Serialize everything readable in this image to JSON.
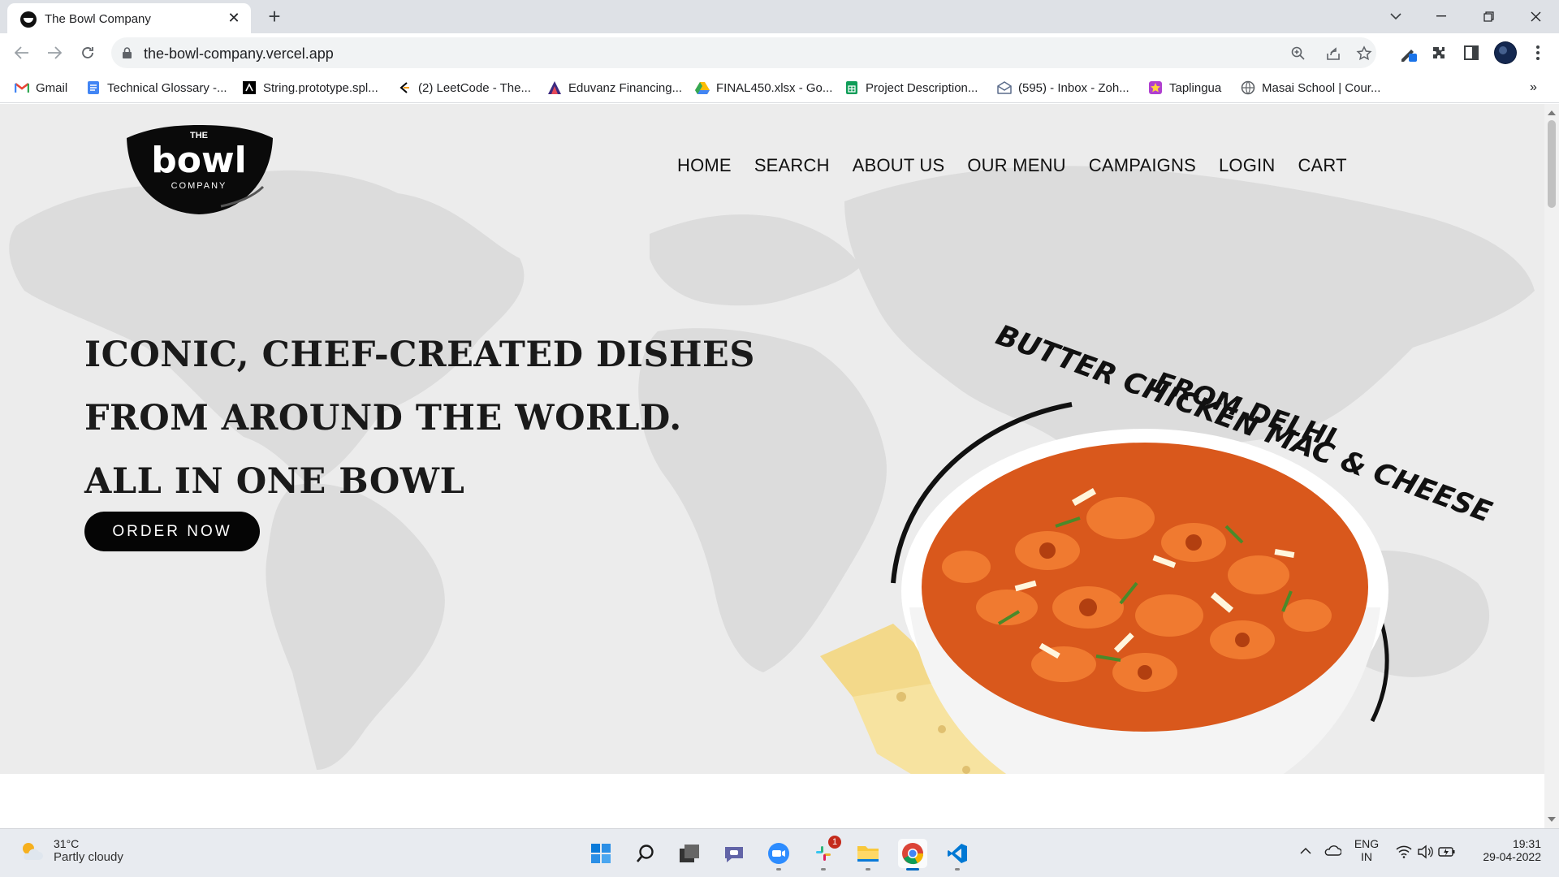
{
  "browser": {
    "tab": {
      "title": "The Bowl Company"
    },
    "url": "the-bowl-company.vercel.app",
    "bookmarks": [
      {
        "label": "Gmail",
        "icon": "gmail-icon"
      },
      {
        "label": "Technical Glossary -...",
        "icon": "docs-icon"
      },
      {
        "label": "String.prototype.spl...",
        "icon": "mdn-icon"
      },
      {
        "label": "(2) LeetCode - The...",
        "icon": "leetcode-icon"
      },
      {
        "label": "Eduvanz Financing...",
        "icon": "eduvanz-icon"
      },
      {
        "label": "FINAL450.xlsx - Go...",
        "icon": "drive-icon"
      },
      {
        "label": "Project Description...",
        "icon": "sheets-icon"
      },
      {
        "label": "(595) - Inbox - Zoh...",
        "icon": "zoho-mail-icon"
      },
      {
        "label": "Taplingua",
        "icon": "taplingua-icon"
      },
      {
        "label": "Masai School | Cour...",
        "icon": "globe-icon"
      }
    ]
  },
  "site": {
    "logo": {
      "top": "THE",
      "main": "bowl",
      "bottom": "COMPANY"
    },
    "nav": [
      "HOME",
      "SEARCH",
      "ABOUT US",
      "OUR MENU",
      "CAMPAIGNS",
      "LOGIN",
      "CART"
    ],
    "hero": {
      "lines": [
        "ICONIC, CHEF-CREATED DISHES",
        "FROM AROUND THE WORLD.",
        "ALL IN ONE BOWL"
      ],
      "cta": "ORDER NOW",
      "dish_caption_line1": "BUTTER CHICKEN MAC & CHEESE",
      "dish_caption_line2": "FROM DELHI"
    }
  },
  "taskbar": {
    "weather": {
      "temp": "31°C",
      "condition": "Partly cloudy"
    },
    "slack_badge": "1",
    "lang": {
      "line1": "ENG",
      "line2": "IN"
    },
    "clock": {
      "time": "19:31",
      "date": "29-04-2022"
    }
  },
  "colors": {
    "hero_bg": "#ececec",
    "cta_bg": "#050505",
    "sauce": "#e8702a"
  }
}
